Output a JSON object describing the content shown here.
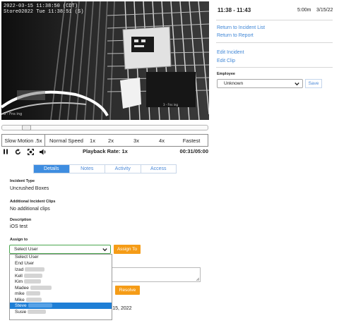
{
  "video": {
    "timestamp_line1": "2022-03-15 11:38:50 (CDT)",
    "timestamp_line2": "Store02022 Tue 11:38:51 (S)",
    "camera_name": "3 - Fns ing",
    "camera_label": "3 - Fns ing",
    "scrub_position": 0.1
  },
  "speeds": {
    "slow": "Slow Motion .5x",
    "normal": "Normal Speed",
    "x1": "1x",
    "x2": "2x",
    "x3": "3x",
    "x4": "4x",
    "fastest": "Fastest"
  },
  "playback": {
    "rate": "Playback Rate: 1x",
    "time": "00:31/05:00"
  },
  "tabs": [
    "Details",
    "Notes",
    "Activity",
    "Access"
  ],
  "details": {
    "incident_type_label": "Incident Type",
    "incident_type": "Uncrushed Boxes",
    "clips_label": "Additional Incident Clips",
    "clips_value": "No additional clips",
    "description_label": "Description",
    "description_value": "iOS test",
    "assign_label": "Assign to",
    "assign_select": "Select User",
    "assign_button": "Assign To",
    "resolve_button": "Resolve",
    "date_fragment": "r 15, 2022"
  },
  "dropdown": {
    "options": [
      "Select User",
      "End User",
      "Izad",
      "Kell",
      "Kim",
      "Madee",
      "mike",
      "Mike",
      "Steve",
      "Susie"
    ],
    "selected": "Steve"
  },
  "panel": {
    "time_range": "11:38 - 11:43",
    "duration": "5:00m",
    "date": "3/15/22",
    "links": [
      "Return to Incident List",
      "Return to Report",
      "Edit Incident",
      "Edit Clip"
    ],
    "employee_label": "Employee",
    "employee_value": "Unknown",
    "save_label": "Save"
  },
  "colors": {
    "accent": "#3e8de0",
    "link": "#3f86d6",
    "orange": "#f59c17",
    "selected_row": "#1f7fd6"
  },
  "icons": {
    "pause": "pause-icon",
    "replay": "replay-icon",
    "fullscreen": "fullscreen-icon",
    "volume": "volume-icon",
    "chevron": "chevron-down-icon"
  }
}
